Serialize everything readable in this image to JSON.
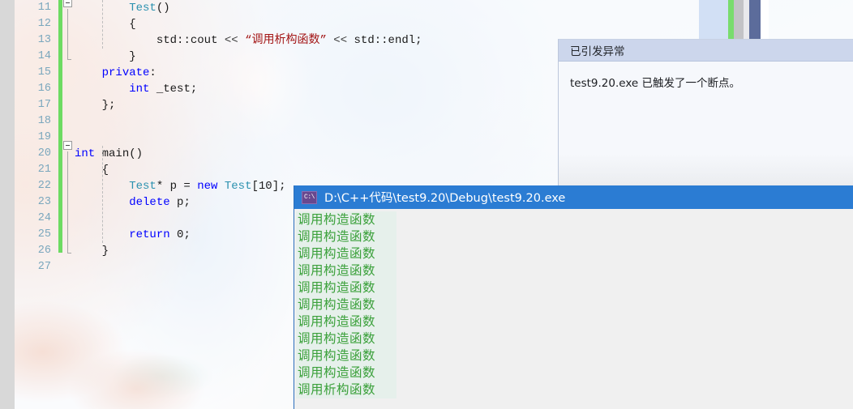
{
  "editor": {
    "name": "visual-studio-editor",
    "first_line_number": 11,
    "line_numbers": [
      11,
      12,
      13,
      14,
      15,
      16,
      17,
      18,
      19,
      20,
      21,
      22,
      23,
      24,
      25,
      26,
      27
    ],
    "change_bar_color": "#6ddb62",
    "lines": [
      {
        "n": 11,
        "indent": 8,
        "text": "Test()"
      },
      {
        "n": 12,
        "indent": 8,
        "text": "{"
      },
      {
        "n": 13,
        "indent": 12,
        "text": "std::cout << “调用析构函数” << std::endl;"
      },
      {
        "n": 14,
        "indent": 8,
        "text": "}"
      },
      {
        "n": 15,
        "indent": 4,
        "text": "private:"
      },
      {
        "n": 16,
        "indent": 8,
        "text": "int _test;"
      },
      {
        "n": 17,
        "indent": 4,
        "text": "};"
      },
      {
        "n": 18,
        "indent": 0,
        "text": ""
      },
      {
        "n": 19,
        "indent": 0,
        "text": ""
      },
      {
        "n": 20,
        "indent": 0,
        "text": "int main()"
      },
      {
        "n": 21,
        "indent": 4,
        "text": "{"
      },
      {
        "n": 22,
        "indent": 8,
        "text": "Test* p = new Test[10];"
      },
      {
        "n": 23,
        "indent": 8,
        "text": "delete p;"
      },
      {
        "n": 24,
        "indent": 0,
        "text": ""
      },
      {
        "n": 25,
        "indent": 8,
        "text": "return 0;"
      },
      {
        "n": 26,
        "indent": 4,
        "text": "}"
      },
      {
        "n": 27,
        "indent": 0,
        "text": ""
      }
    ],
    "code_tokens": {
      "l11": [
        [
          "Test",
          "tok-type"
        ],
        [
          "()",
          "tok-punct"
        ]
      ],
      "l12": [
        [
          "{",
          "tok-punct"
        ]
      ],
      "l13": [
        [
          "std",
          "tok-ns"
        ],
        [
          "::",
          "tok-punct"
        ],
        [
          "cout ",
          "tok-plain"
        ],
        [
          "<< ",
          "tok-op"
        ],
        [
          "“调用析构函数”",
          "tok-str"
        ],
        [
          " << ",
          "tok-op"
        ],
        [
          "std",
          "tok-ns"
        ],
        [
          "::",
          "tok-punct"
        ],
        [
          "endl;",
          "tok-plain"
        ]
      ],
      "l14": [
        [
          "}",
          "tok-punct"
        ]
      ],
      "l15": [
        [
          "private",
          "tok-kw"
        ],
        [
          ":",
          "tok-punct"
        ]
      ],
      "l16": [
        [
          "int",
          "tok-kw"
        ],
        [
          " _test;",
          "tok-plain"
        ]
      ],
      "l17": [
        [
          "};",
          "tok-punct"
        ]
      ],
      "l20": [
        [
          "int",
          "tok-kw"
        ],
        [
          " main()",
          "tok-plain"
        ]
      ],
      "l21": [
        [
          "{",
          "tok-punct"
        ]
      ],
      "l22": [
        [
          "Test",
          "tok-type"
        ],
        [
          "* p = ",
          "tok-plain"
        ],
        [
          "new",
          "tok-kw"
        ],
        [
          " ",
          "tok-plain"
        ],
        [
          "Test",
          "tok-type"
        ],
        [
          "[",
          "tok-punct"
        ],
        [
          "10",
          "tok-num"
        ],
        [
          "];",
          "tok-punct"
        ]
      ],
      "l23": [
        [
          "delete",
          "tok-kw"
        ],
        [
          " p;",
          "tok-plain"
        ]
      ],
      "l25": [
        [
          "return",
          "tok-kw"
        ],
        [
          " ",
          "tok-plain"
        ],
        [
          "0",
          "tok-num"
        ],
        [
          ";",
          "tok-punct"
        ]
      ],
      "l26": [
        [
          "}",
          "tok-punct"
        ]
      ]
    },
    "colors": {
      "keyword": "#0000ff",
      "type": "#2b91af",
      "string": "#a31515",
      "line_number": "#7aa7bd",
      "change_bar": "#6ddb62"
    }
  },
  "exception_dialog": {
    "name": "exception-thrown-dialog",
    "title": "已引发异常",
    "message": "test9.20.exe 已触发了一个断点。",
    "header_color": "#ccd6ec",
    "body_color": "#f6f8fc"
  },
  "console_window": {
    "name": "debug-console-window",
    "icon": "console-icon",
    "icon_glyph": "C:\\",
    "title": "D:\\C++代码\\test9.20\\Debug\\test9.20.exe",
    "title_bar_color": "#2b7cd3",
    "background_color": "#f0f0f0",
    "text_color": "#3aa03a",
    "lines": [
      "调用构造函数",
      "调用构造函数",
      "调用构造函数",
      "调用构造函数",
      "调用构造函数",
      "调用构造函数",
      "调用构造函数",
      "调用构造函数",
      "调用构造函数",
      "调用构造函数",
      "调用析构函数"
    ]
  },
  "scrollbar": {
    "name": "editor-vertical-scrollbar",
    "thumb_color": "#5c6c9b",
    "marker_color": "#79dc6d"
  }
}
